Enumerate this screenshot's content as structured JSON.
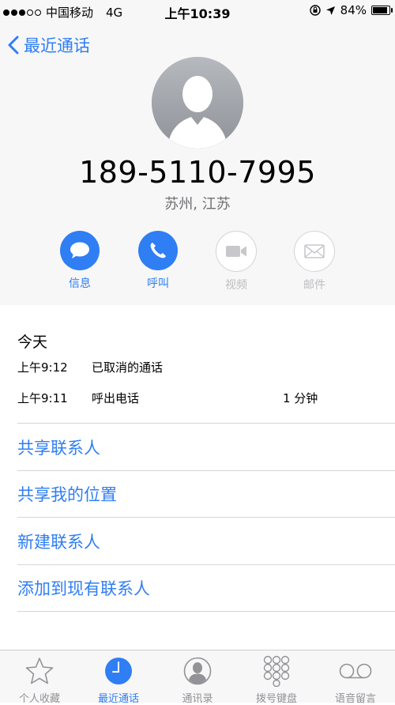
{
  "status_bar": {
    "carrier": "中国移动",
    "network": "4G",
    "time": "上午10:39",
    "battery_percent": "84%",
    "battery_level": 0.84
  },
  "nav": {
    "back_label": "最近通话"
  },
  "contact": {
    "number": "189-5110-7995",
    "location": "苏州, 江苏"
  },
  "actions": [
    {
      "label": "信息",
      "enabled": true,
      "icon": "message-icon"
    },
    {
      "label": "呼叫",
      "enabled": true,
      "icon": "phone-icon"
    },
    {
      "label": "视频",
      "enabled": false,
      "icon": "video-icon"
    },
    {
      "label": "邮件",
      "enabled": false,
      "icon": "mail-icon"
    }
  ],
  "recents": {
    "day_label": "今天",
    "calls": [
      {
        "time": "上午9:12",
        "type": "已取消的通话",
        "duration": ""
      },
      {
        "time": "上午9:11",
        "type": "呼出电话",
        "duration": "1 分钟"
      }
    ]
  },
  "links": {
    "share_contact": "共享联系人",
    "share_location": "共享我的位置",
    "new_contact": "新建联系人",
    "add_existing": "添加到现有联系人"
  },
  "tabs": [
    {
      "label": "个人收藏",
      "icon": "star-icon",
      "active": false
    },
    {
      "label": "最近通话",
      "icon": "clock-icon",
      "active": true
    },
    {
      "label": "通讯录",
      "icon": "contacts-icon",
      "active": false
    },
    {
      "label": "拨号键盘",
      "icon": "keypad-icon",
      "active": false
    },
    {
      "label": "语音留言",
      "icon": "voicemail-icon",
      "active": false
    }
  ],
  "colors": {
    "accent": "#2f7ef4",
    "disabled": "#bdbdc1"
  }
}
